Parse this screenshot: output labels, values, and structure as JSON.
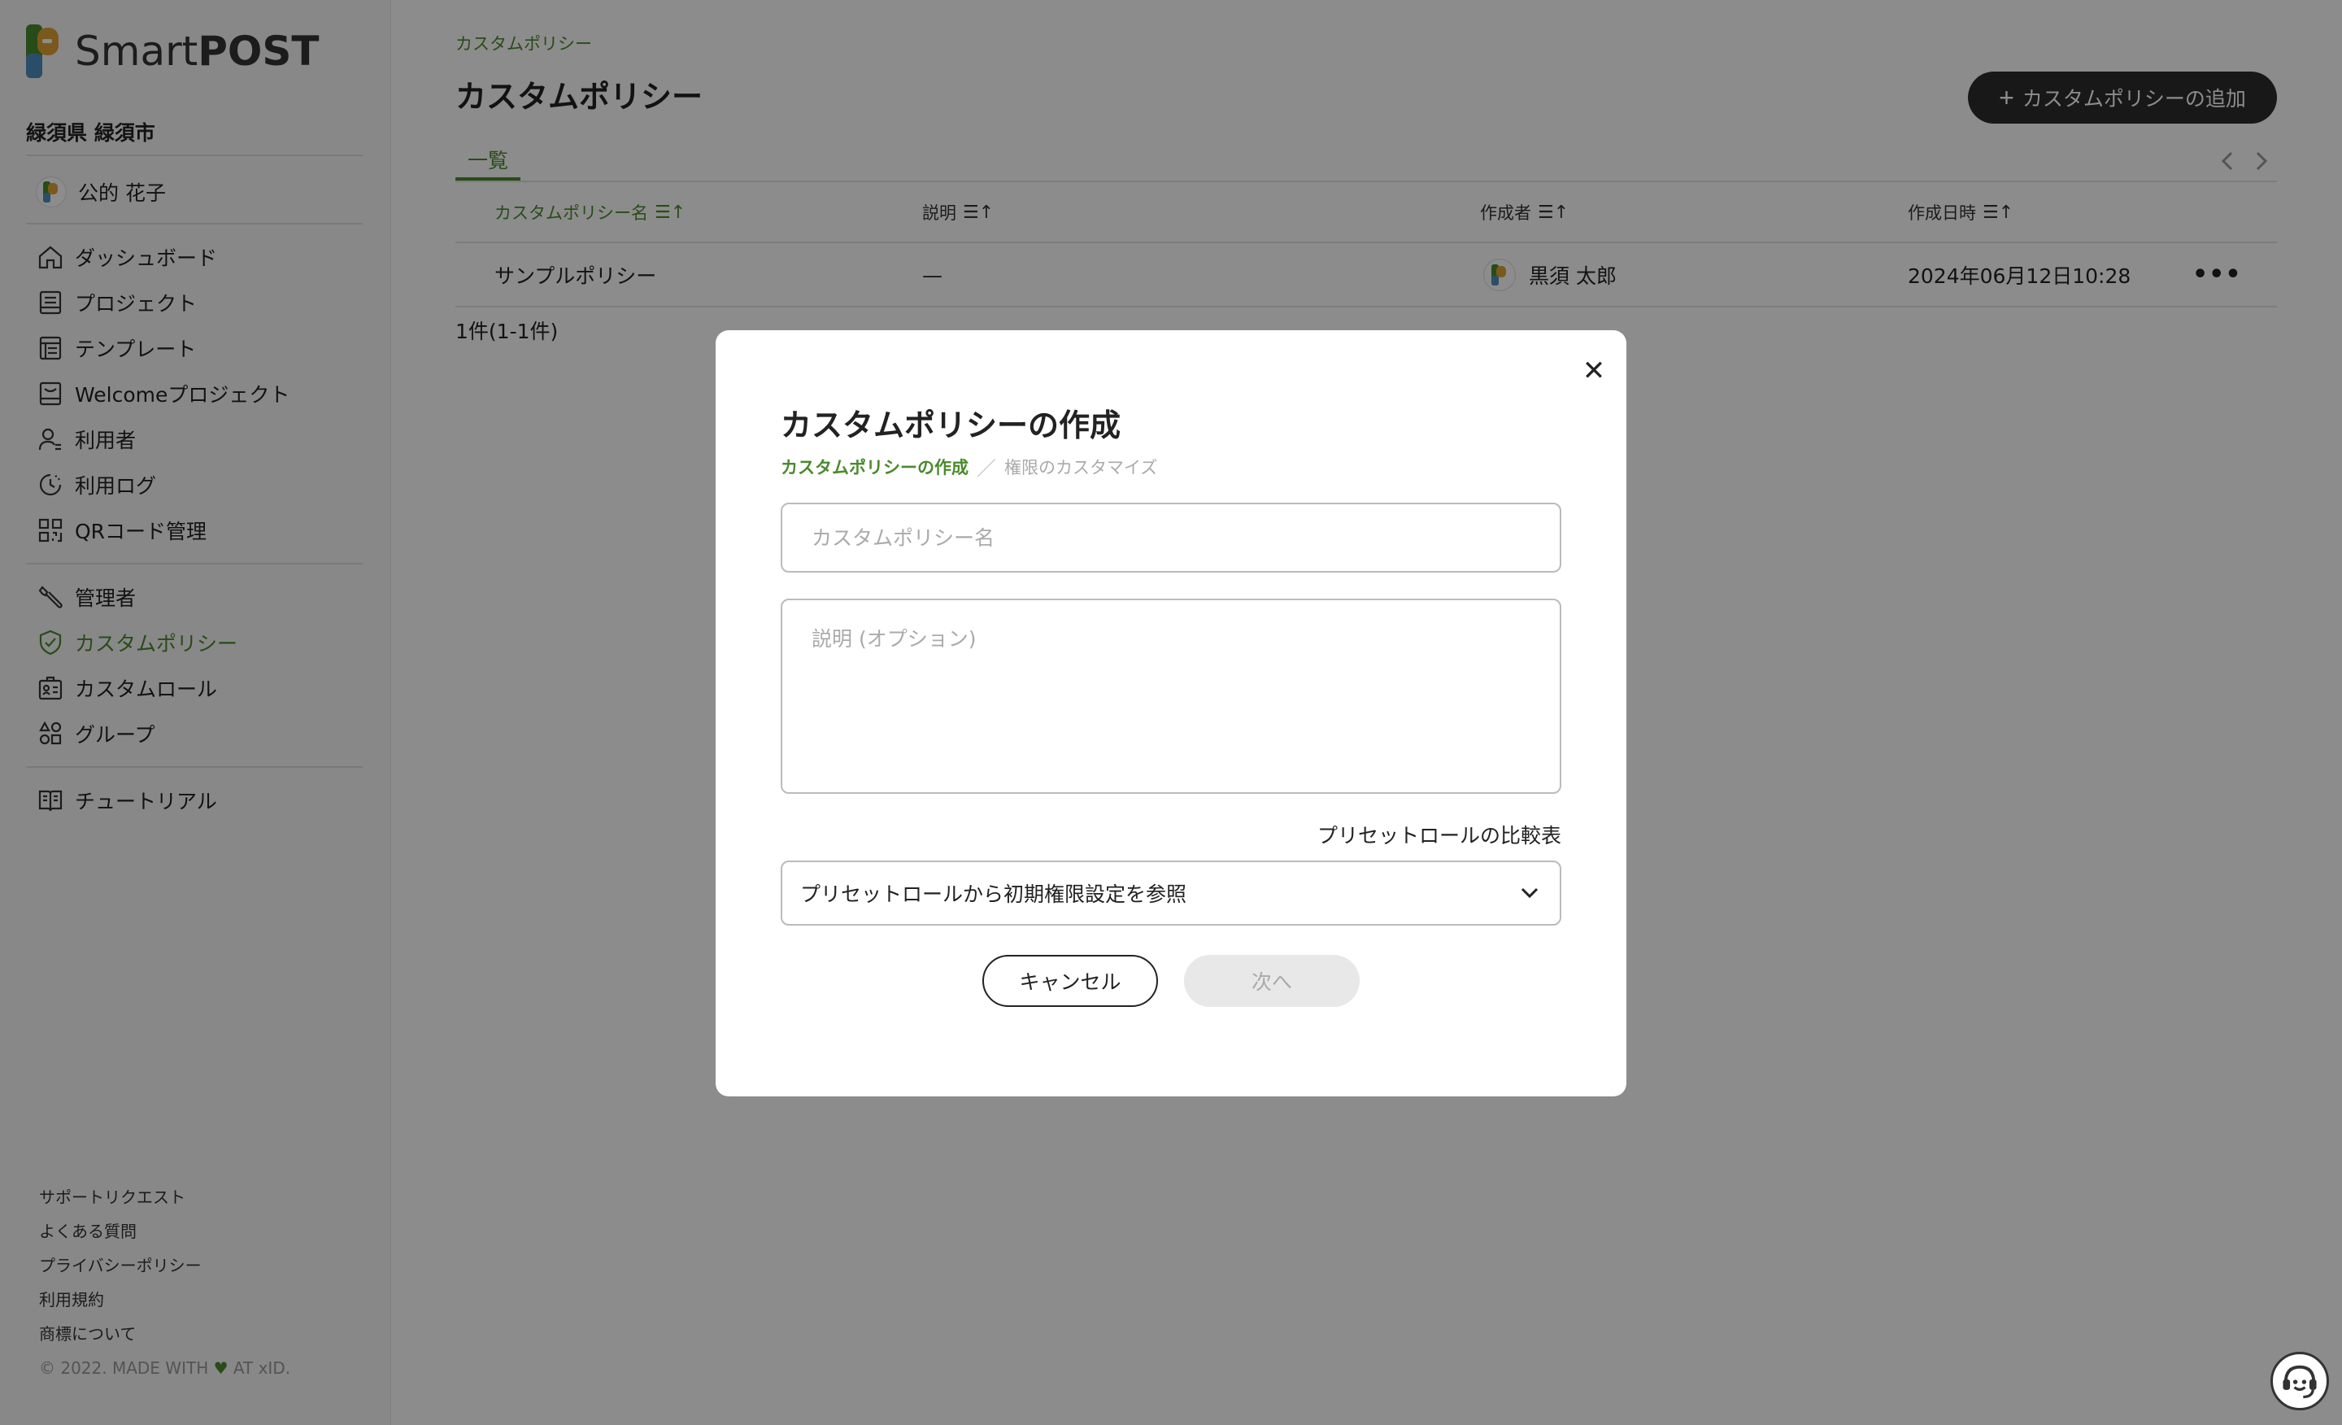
{
  "brand": {
    "name_light": "Smart",
    "name_bold": "POST"
  },
  "sidebar": {
    "org_name": "緑須県 緑須市",
    "user_name": "公的 花子",
    "nav_main": [
      {
        "label": "ダッシュボード",
        "icon": "home-icon"
      },
      {
        "label": "プロジェクト",
        "icon": "project-icon"
      },
      {
        "label": "テンプレート",
        "icon": "template-icon"
      },
      {
        "label": "Welcomeプロジェクト",
        "icon": "welcome-project-icon"
      },
      {
        "label": "利用者",
        "icon": "user-icon"
      },
      {
        "label": "利用ログ",
        "icon": "log-icon"
      },
      {
        "label": "QRコード管理",
        "icon": "qr-code-icon"
      }
    ],
    "nav_admin": [
      {
        "label": "管理者",
        "icon": "wrench-icon"
      },
      {
        "label": "カスタムポリシー",
        "icon": "shield-icon",
        "active": true
      },
      {
        "label": "カスタムロール",
        "icon": "id-card-icon"
      },
      {
        "label": "グループ",
        "icon": "group-icon"
      }
    ],
    "nav_help": [
      {
        "label": "チュートリアル",
        "icon": "book-icon"
      }
    ],
    "footer_links": [
      "サポートリクエスト",
      "よくある質問",
      "プライバシーポリシー",
      "利用規約",
      "商標について"
    ],
    "copyright_pre": "© 2022. MADE WITH",
    "copyright_post": "AT xID."
  },
  "main": {
    "breadcrumb": "カスタムポリシー",
    "title": "カスタムポリシー",
    "add_button": "カスタムポリシーの追加",
    "tab_label": "一覧",
    "columns": [
      "カスタムポリシー名",
      "説明",
      "作成者",
      "作成日時"
    ],
    "sort_glyph": "☰↑",
    "rows": [
      {
        "name": "サンプルポリシー",
        "description": "—",
        "creator": "黒須 太郎",
        "created_at": "2024年06月12日10:28"
      }
    ],
    "count_text": "1件(1-1件)"
  },
  "modal": {
    "title": "カスタムポリシーの作成",
    "step_active": "カスタムポリシーの作成",
    "step_separator": "／",
    "step_next": "権限のカスタマイズ",
    "name_placeholder": "カスタムポリシー名",
    "description_placeholder": "説明 (オプション)",
    "compare_link": "プリセットロールの比較表",
    "preset_select_value": "プリセットロールから初期権限設定を参照",
    "cancel_label": "キャンセル",
    "next_label": "次へ",
    "close_glyph": "✕"
  },
  "colors": {
    "accent_green": "#4a8a2c",
    "dark_button": "#2d2d2d",
    "overlay": "rgba(0,0,0,0.45)"
  }
}
